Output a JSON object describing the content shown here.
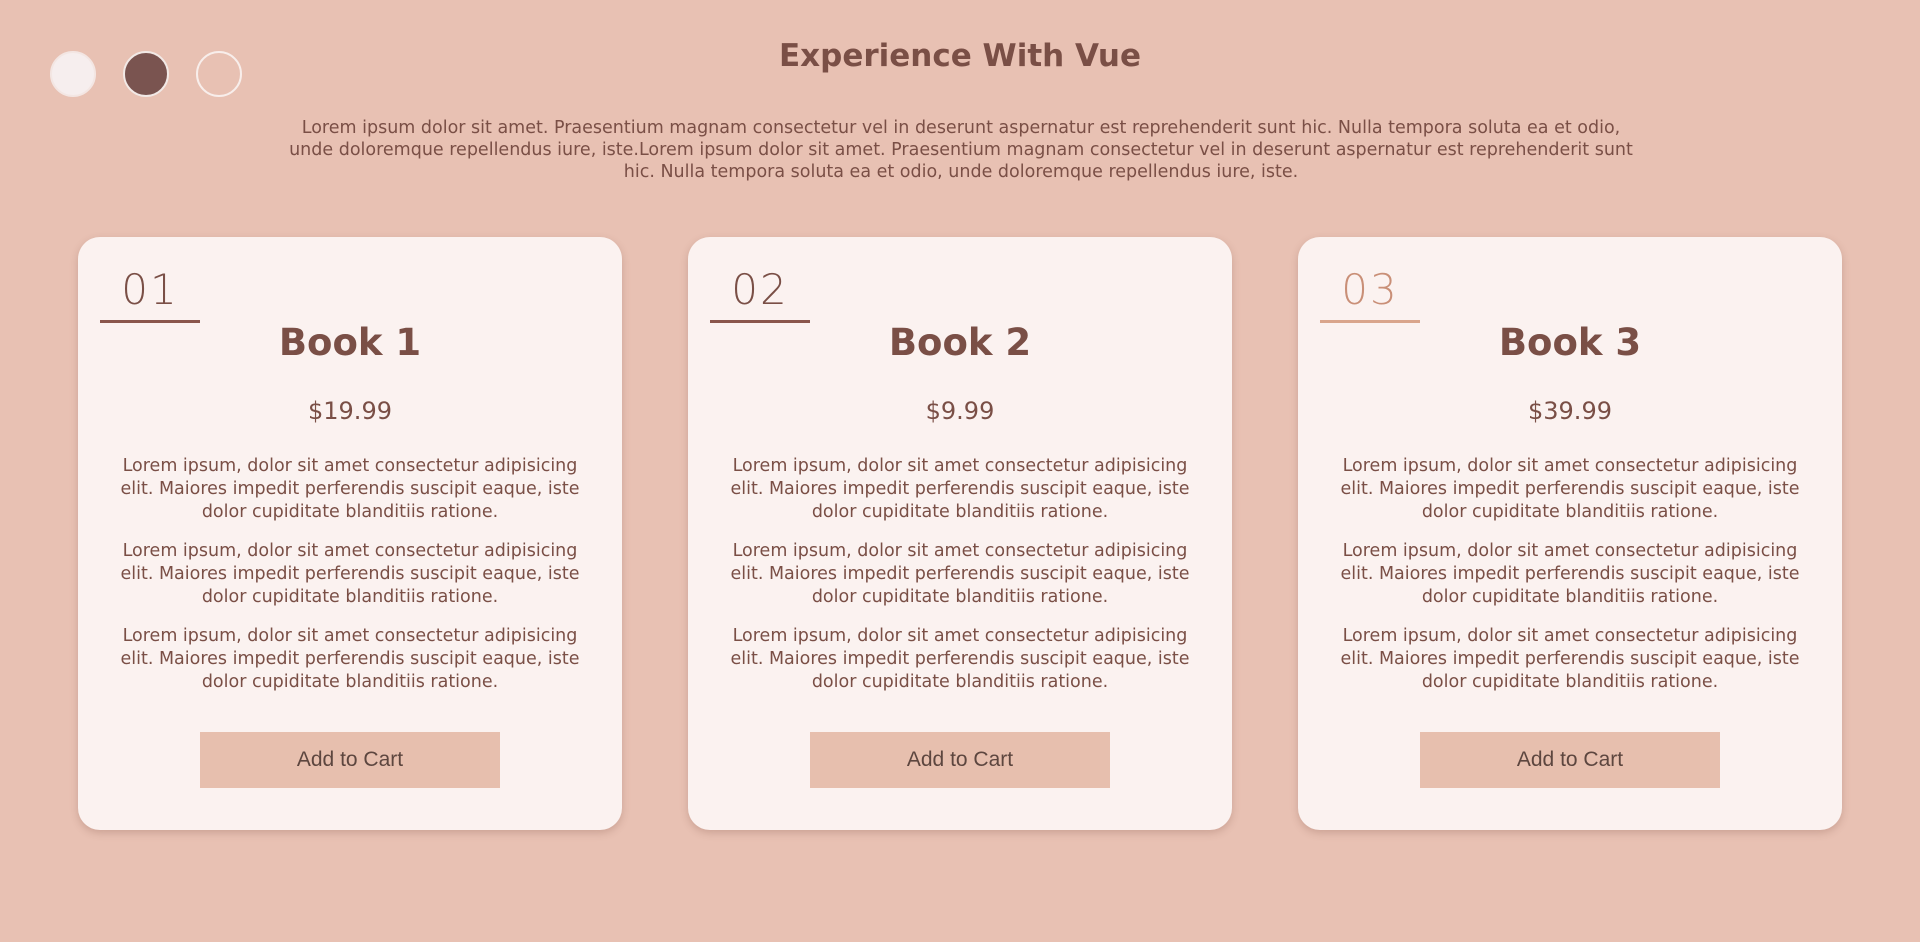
{
  "theme_switcher": {
    "options": [
      "light",
      "dark",
      "outline"
    ]
  },
  "header": {
    "title": "Experience With Vue",
    "intro": "Lorem ipsum dolor sit amet. Praesentium magnam consectetur vel in deserunt aspernatur est reprehenderit sunt hic. Nulla tempora soluta ea et odio, unde doloremque repellendus iure, iste.Lorem ipsum dolor sit amet. Praesentium magnam consectetur vel in deserunt aspernatur est reprehenderit sunt hic. Nulla tempora soluta ea et odio, unde doloremque repellendus iure, iste."
  },
  "cards": [
    {
      "number": "01",
      "title": "Book 1",
      "price": "$19.99",
      "paragraphs": [
        "Lorem ipsum, dolor sit amet consectetur adipisicing elit. Maiores impedit perferendis suscipit eaque, iste dolor cupiditate blanditiis ratione.",
        "Lorem ipsum, dolor sit amet consectetur adipisicing elit. Maiores impedit perferendis suscipit eaque, iste dolor cupiditate blanditiis ratione.",
        "Lorem ipsum, dolor sit amet consectetur adipisicing elit. Maiores impedit perferendis suscipit eaque, iste dolor cupiditate blanditiis ratione."
      ],
      "button_label": "Add to Cart"
    },
    {
      "number": "02",
      "title": "Book 2",
      "price": "$9.99",
      "paragraphs": [
        "Lorem ipsum, dolor sit amet consectetur adipisicing elit. Maiores impedit perferendis suscipit eaque, iste dolor cupiditate blanditiis ratione.",
        "Lorem ipsum, dolor sit amet consectetur adipisicing elit. Maiores impedit perferendis suscipit eaque, iste dolor cupiditate blanditiis ratione.",
        "Lorem ipsum, dolor sit amet consectetur adipisicing elit. Maiores impedit perferendis suscipit eaque, iste dolor cupiditate blanditiis ratione."
      ],
      "button_label": "Add to Cart"
    },
    {
      "number": "03",
      "title": "Book 3",
      "price": "$39.99",
      "paragraphs": [
        "Lorem ipsum, dolor sit amet consectetur adipisicing elit. Maiores impedit perferendis suscipit eaque, iste dolor cupiditate blanditiis ratione.",
        "Lorem ipsum, dolor sit amet consectetur adipisicing elit. Maiores impedit perferendis suscipit eaque, iste dolor cupiditate blanditiis ratione.",
        "Lorem ipsum, dolor sit amet consectetur adipisicing elit. Maiores impedit perferendis suscipit eaque, iste dolor cupiditate blanditiis ratione."
      ],
      "button_label": "Add to Cart"
    }
  ],
  "colors": {
    "background": "#e8c1b3",
    "card": "#fbf2f0",
    "text": "#7a4f46",
    "button": "#e7bfae",
    "number_accent": "#c98f77"
  }
}
